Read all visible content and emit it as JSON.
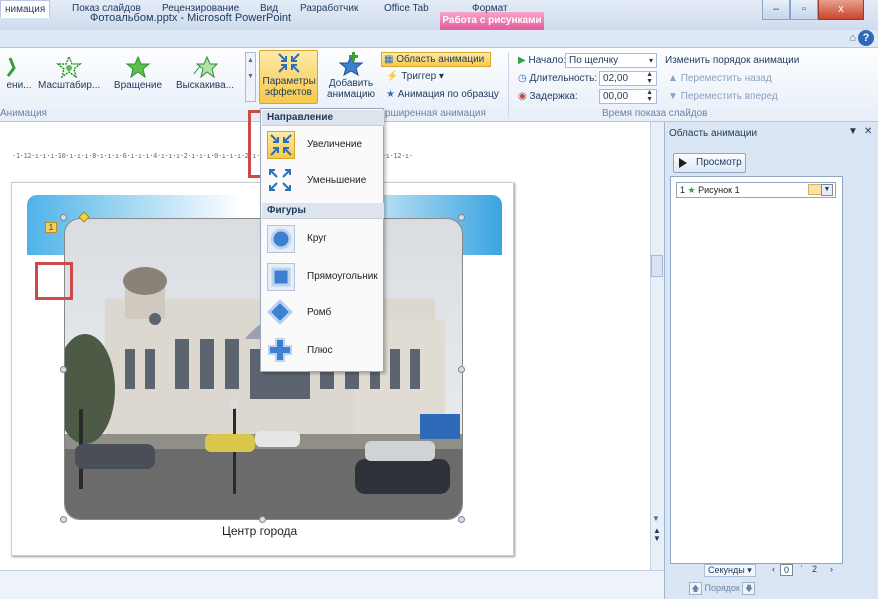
{
  "window": {
    "title": "Фотоальбом.pptx - Microsoft PowerPoint",
    "context_tab": "Работа с рисунками",
    "buttons": {
      "minimize": "–",
      "maximize": "▫",
      "close": "x"
    }
  },
  "tabs": [
    {
      "label": "нимация"
    },
    {
      "label": "Показ слайдов"
    },
    {
      "label": "Рецензирование"
    },
    {
      "label": "Вид"
    },
    {
      "label": "Разработчик"
    },
    {
      "label": "Office Tab"
    },
    {
      "label": "Формат"
    }
  ],
  "ribbon": {
    "gallery": {
      "item_partial": "ени...",
      "item1": "Масштабир...",
      "item2": "Вращение",
      "item3": "Выскакива..."
    },
    "effect_options": "Параметры эффектов",
    "add_animation": "Добавить анимацию",
    "animation_pane": "Область анимации",
    "trigger": "Триггер",
    "animation_painter": "Анимация по образцу",
    "group_anim": "Анимация",
    "group_advanced": "рширенная анимация",
    "timing": {
      "start_label": "Начало:",
      "start_value": "По щелчку",
      "duration_label": "Длительность:",
      "duration_value": "02,00",
      "delay_label": "Задержка:",
      "delay_value": "00,00",
      "group": "Время показа слайдов"
    },
    "reorder": {
      "title": "Изменить порядок анимации",
      "earlier": "Переместить назад",
      "later": "Переместить вперед"
    }
  },
  "ruler": {
    "text": "·1·12·ı·ı·ı·10·ı·ı·ı·8·ı·ı·ı·6·ı·ı·ı·4·ı·ı·ı·2·ı·ı·ı·0·ı·ı·ı·2·ı·ı·ı·4·ı·ı·ı·6·ı·ı·ı·8·ı·ı·ı·10·ı·ı·12·ı·"
  },
  "slide": {
    "caption": "Центр города",
    "anim_tag": "1"
  },
  "menu": {
    "direction_header": "Направление",
    "shapes_header": "Фигуры",
    "items": {
      "in": "Увеличение",
      "out": "Уменьшение",
      "circle": "Круг",
      "box": "Прямоугольник",
      "diamond": "Ромб",
      "plus": "Плюс"
    }
  },
  "pane": {
    "title": "Область анимации",
    "preview": "Просмотр",
    "row": {
      "index": "1",
      "name": "Рисунок 1"
    },
    "seconds": "Секунды",
    "sec_from": "0",
    "sec_to": "2",
    "order": "Порядок"
  }
}
